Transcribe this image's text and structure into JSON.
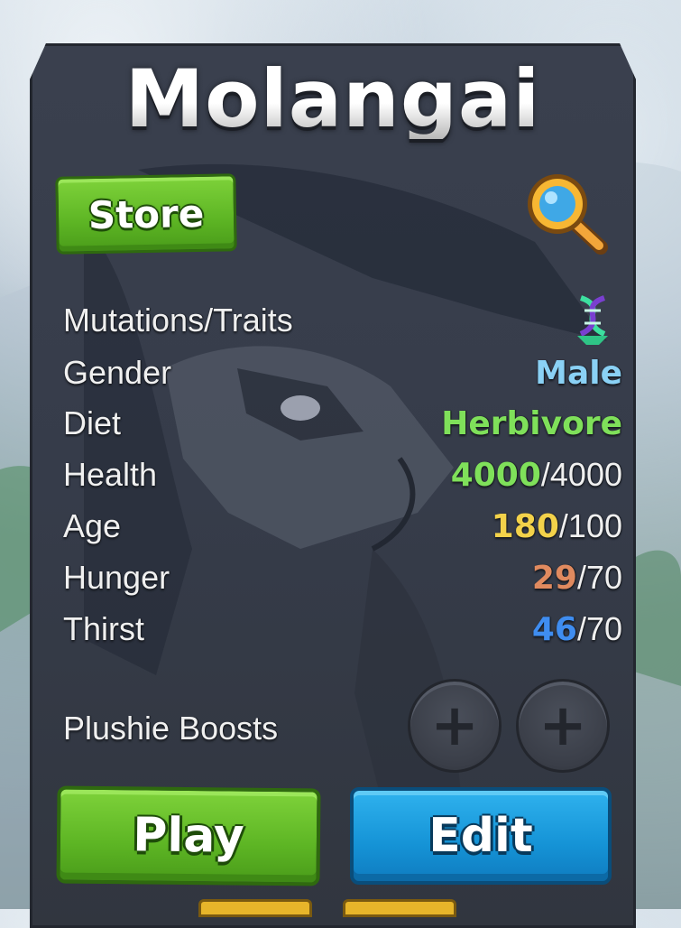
{
  "creature": {
    "name": "Molangai"
  },
  "header": {
    "store_label": "Store",
    "search_icon": "magnifier-icon"
  },
  "stats": {
    "mutations_label": "Mutations/Traits",
    "mutations_icon": "dna-trait-icon",
    "gender": {
      "label": "Gender",
      "value": "Male",
      "color": "#8ad1f5"
    },
    "diet": {
      "label": "Diet",
      "value": "Herbivore",
      "color": "#7fe05a"
    },
    "health": {
      "label": "Health",
      "current": "4000",
      "max": "/4000",
      "color": "#7fe05a"
    },
    "age": {
      "label": "Age",
      "current": "180",
      "max": "/100",
      "color": "#f3d24a"
    },
    "hunger": {
      "label": "Hunger",
      "current": "29",
      "max": "/70",
      "color": "#e08a5f"
    },
    "thirst": {
      "label": "Thirst",
      "current": "46",
      "max": "/70",
      "color": "#3f8df0"
    }
  },
  "plushie": {
    "label": "Plushie Boosts",
    "slot_symbol": "+"
  },
  "actions": {
    "play_label": "Play",
    "edit_label": "Edit"
  },
  "colors": {
    "panel": "#363c4a",
    "green_button": "#5db524",
    "blue_button": "#1593d6",
    "bottom_tab": "#e7b52a"
  }
}
